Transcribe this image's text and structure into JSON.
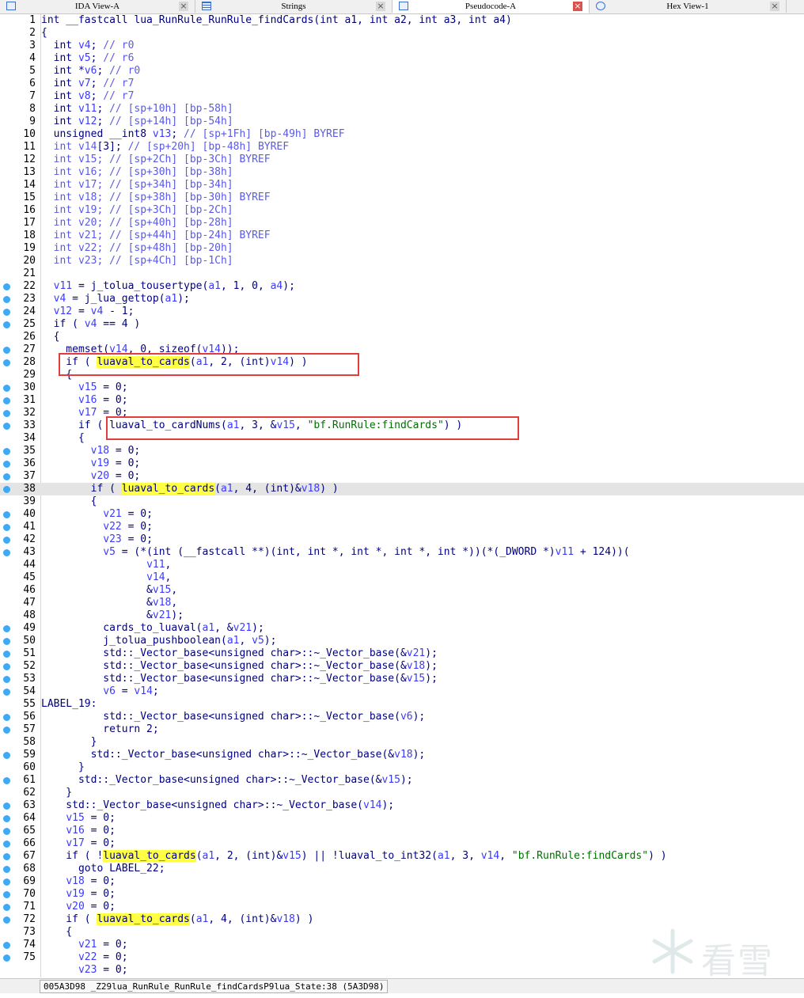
{
  "tabs": [
    {
      "label": "IDA View-A",
      "close": "×"
    },
    {
      "label": "Strings",
      "close": "×"
    },
    {
      "label": "Pseudocode-A",
      "close": "×"
    },
    {
      "label": "Hex View-1",
      "close": "×"
    }
  ],
  "current_line": 38,
  "highlighted_lines": [
    28,
    33
  ],
  "watermark": "看雪",
  "status": "005A3D98 _Z29lua_RunRule_RunRule_findCardsP9lua_State:38 (5A3D98)",
  "lines": [
    {
      "n": "1",
      "bp": false,
      "html": "int __fastcall lua_RunRule_RunRule_findCards(int a1, int a2, int a3, int a4)"
    },
    {
      "n": "2",
      "bp": false,
      "html": "{"
    },
    {
      "n": "3",
      "bp": false,
      "html": "  int <span class=\"v\">v4</span>; <span class=\"c\">// r0</span>"
    },
    {
      "n": "4",
      "bp": false,
      "html": "  int <span class=\"v\">v5</span>; <span class=\"c\">// r6</span>"
    },
    {
      "n": "5",
      "bp": false,
      "html": "  int *<span class=\"v\">v6</span>; <span class=\"c\">// r0</span>"
    },
    {
      "n": "6",
      "bp": false,
      "html": "  int <span class=\"v\">v7</span>; <span class=\"c\">// r7</span>"
    },
    {
      "n": "7",
      "bp": false,
      "html": "  int <span class=\"v\">v8</span>; <span class=\"c\">// r7</span>"
    },
    {
      "n": "8",
      "bp": false,
      "html": "  int <span class=\"v\">v11</span>; <span class=\"c\">// [sp+10h] [bp-58h]</span>"
    },
    {
      "n": "9",
      "bp": false,
      "html": "  int <span class=\"v\">v12</span>; <span class=\"c\">// [sp+14h] [bp-54h]</span>"
    },
    {
      "n": "10",
      "bp": false,
      "html": "  unsigned __int8 <span class=\"v\">v13</span>; <span class=\"c\">// [sp+1Fh] [bp-49h] BYREF</span>"
    },
    {
      "n": "11",
      "bp": false,
      "html": "  <span class=\"c\">int v14</span>[3]; <span class=\"c\">// [sp+20h] [bp-48h] BYREF</span>"
    },
    {
      "n": "12",
      "bp": false,
      "html": "  <span class=\"c\">int v15; // [sp+2Ch] [bp-3Ch] BYREF</span>"
    },
    {
      "n": "13",
      "bp": false,
      "html": "  <span class=\"c\">int v16; // [sp+30h] [bp-38h]</span>"
    },
    {
      "n": "14",
      "bp": false,
      "html": "  <span class=\"c\">int v17; // [sp+34h] [bp-34h]</span>"
    },
    {
      "n": "15",
      "bp": false,
      "html": "  <span class=\"c\">int v18; // [sp+38h] [bp-30h] BYREF</span>"
    },
    {
      "n": "16",
      "bp": false,
      "html": "  <span class=\"c\">int v19; // [sp+3Ch] [bp-2Ch]</span>"
    },
    {
      "n": "17",
      "bp": false,
      "html": "  <span class=\"c\">int v20; // [sp+40h] [bp-28h]</span>"
    },
    {
      "n": "18",
      "bp": false,
      "html": "  <span class=\"c\">int v21; // [sp+44h] [bp-24h] BYREF</span>"
    },
    {
      "n": "19",
      "bp": false,
      "html": "  <span class=\"c\">int v22; // [sp+48h] [bp-20h]</span>"
    },
    {
      "n": "20",
      "bp": false,
      "html": "  <span class=\"c\">int v23; // [sp+4Ch] [bp-1Ch]</span>"
    },
    {
      "n": "21",
      "bp": false,
      "html": ""
    },
    {
      "n": "22",
      "bp": true,
      "html": "  <span class=\"v\">v11</span> = j_tolua_tousertype(<span class=\"v\">a1</span>, 1, 0, <span class=\"v\">a4</span>);"
    },
    {
      "n": "23",
      "bp": true,
      "html": "  <span class=\"v\">v4</span> = j_lua_gettop(<span class=\"v\">a1</span>);"
    },
    {
      "n": "24",
      "bp": true,
      "html": "  <span class=\"v\">v12</span> = <span class=\"v\">v4</span> - 1;"
    },
    {
      "n": "25",
      "bp": true,
      "html": "  if ( <span class=\"v\">v4</span> == 4 )"
    },
    {
      "n": "26",
      "bp": false,
      "html": "  {"
    },
    {
      "n": "27",
      "bp": true,
      "html": "    memset(<span class=\"v\">v14</span>, 0, sizeof(<span class=\"v\">v14</span>));"
    },
    {
      "n": "28",
      "bp": true,
      "html": "    if ( <span class=\"hl\">luaval_to_cards</span>(<span class=\"v\">a1</span>, 2, (int)<span class=\"v\">v14</span>) )"
    },
    {
      "n": "29",
      "bp": false,
      "html": "    {"
    },
    {
      "n": "30",
      "bp": true,
      "html": "      <span class=\"v\">v15</span> = 0;"
    },
    {
      "n": "31",
      "bp": true,
      "html": "      <span class=\"v\">v16</span> = 0;"
    },
    {
      "n": "32",
      "bp": true,
      "html": "      <span class=\"v\">v17</span> = 0;"
    },
    {
      "n": "33",
      "bp": true,
      "html": "      if ( luaval_to_cardNums(<span class=\"v\">a1</span>, 3, &amp;<span class=\"v\">v15</span>, <span class=\"s\">\"bf.RunRule:findCards\"</span>) )"
    },
    {
      "n": "34",
      "bp": false,
      "html": "      {"
    },
    {
      "n": "35",
      "bp": true,
      "html": "        <span class=\"v\">v18</span> = 0;"
    },
    {
      "n": "36",
      "bp": true,
      "html": "        <span class=\"v\">v19</span> = 0;"
    },
    {
      "n": "37",
      "bp": true,
      "html": "        <span class=\"v\">v20</span> = 0;"
    },
    {
      "n": "38",
      "bp": true,
      "html": "        if ( <span class=\"hl\">luaval_to_cards</span>(<span class=\"v\">a1</span>, 4, (int)&amp;<span class=\"v\">v18</span>) )"
    },
    {
      "n": "39",
      "bp": false,
      "html": "        {"
    },
    {
      "n": "40",
      "bp": true,
      "html": "          <span class=\"v\">v21</span> = 0;"
    },
    {
      "n": "41",
      "bp": true,
      "html": "          <span class=\"v\">v22</span> = 0;"
    },
    {
      "n": "42",
      "bp": true,
      "html": "          <span class=\"v\">v23</span> = 0;"
    },
    {
      "n": "43",
      "bp": true,
      "html": "          <span class=\"v\">v5</span> = (*(int (__fastcall **)(int, int *, int *, int *, int *))(*(_DWORD *)<span class=\"v\">v11</span> + 124))("
    },
    {
      "n": "44",
      "bp": false,
      "html": "                 <span class=\"v\">v11</span>,"
    },
    {
      "n": "45",
      "bp": false,
      "html": "                 <span class=\"v\">v14</span>,"
    },
    {
      "n": "46",
      "bp": false,
      "html": "                 &amp;<span class=\"v\">v15</span>,"
    },
    {
      "n": "47",
      "bp": false,
      "html": "                 &amp;<span class=\"v\">v18</span>,"
    },
    {
      "n": "48",
      "bp": false,
      "html": "                 &amp;<span class=\"v\">v21</span>);"
    },
    {
      "n": "49",
      "bp": true,
      "html": "          cards_to_luaval(<span class=\"v\">a1</span>, &amp;<span class=\"v\">v21</span>);"
    },
    {
      "n": "50",
      "bp": true,
      "html": "          j_tolua_pushboolean(<span class=\"v\">a1</span>, <span class=\"v\">v5</span>);"
    },
    {
      "n": "51",
      "bp": true,
      "html": "          std::_Vector_base&lt;unsigned char&gt;::~_Vector_base(&amp;<span class=\"v\">v21</span>);"
    },
    {
      "n": "52",
      "bp": true,
      "html": "          std::_Vector_base&lt;unsigned char&gt;::~_Vector_base(&amp;<span class=\"v\">v18</span>);"
    },
    {
      "n": "53",
      "bp": true,
      "html": "          std::_Vector_base&lt;unsigned char&gt;::~_Vector_base(&amp;<span class=\"v\">v15</span>);"
    },
    {
      "n": "54",
      "bp": true,
      "html": "          <span class=\"v\">v6</span> = <span class=\"v\">v14</span>;"
    },
    {
      "n": "55",
      "bp": false,
      "html": "LABEL_19:"
    },
    {
      "n": "56",
      "bp": true,
      "html": "          std::_Vector_base&lt;unsigned char&gt;::~_Vector_base(<span class=\"v\">v6</span>);"
    },
    {
      "n": "57",
      "bp": true,
      "html": "          return 2;"
    },
    {
      "n": "58",
      "bp": false,
      "html": "        }"
    },
    {
      "n": "59",
      "bp": true,
      "html": "        std::_Vector_base&lt;unsigned char&gt;::~_Vector_base(&amp;<span class=\"v\">v18</span>);"
    },
    {
      "n": "60",
      "bp": false,
      "html": "      }"
    },
    {
      "n": "61",
      "bp": true,
      "html": "      std::_Vector_base&lt;unsigned char&gt;::~_Vector_base(&amp;<span class=\"v\">v15</span>);"
    },
    {
      "n": "62",
      "bp": false,
      "html": "    }"
    },
    {
      "n": "63",
      "bp": true,
      "html": "    std::_Vector_base&lt;unsigned char&gt;::~_Vector_base(<span class=\"v\">v14</span>);"
    },
    {
      "n": "64",
      "bp": true,
      "html": "    <span class=\"v\">v15</span> = 0;"
    },
    {
      "n": "65",
      "bp": true,
      "html": "    <span class=\"v\">v16</span> = 0;"
    },
    {
      "n": "66",
      "bp": true,
      "html": "    <span class=\"v\">v17</span> = 0;"
    },
    {
      "n": "67",
      "bp": true,
      "html": "    if ( !<span class=\"hl\">luaval_to_cards</span>(<span class=\"v\">a1</span>, 2, (int)&amp;<span class=\"v\">v15</span>) || !luaval_to_int32(<span class=\"v\">a1</span>, 3, <span class=\"v\">v14</span>, <span class=\"s\">\"bf.RunRule:findCards\"</span>) )"
    },
    {
      "n": "68",
      "bp": true,
      "html": "      goto LABEL_22;"
    },
    {
      "n": "69",
      "bp": true,
      "html": "    <span class=\"v\">v18</span> = 0;"
    },
    {
      "n": "70",
      "bp": true,
      "html": "    <span class=\"v\">v19</span> = 0;"
    },
    {
      "n": "71",
      "bp": true,
      "html": "    <span class=\"v\">v20</span> = 0;"
    },
    {
      "n": "72",
      "bp": true,
      "html": "    if ( <span class=\"hl\">luaval_to_cards</span>(<span class=\"v\">a1</span>, 4, (int)&amp;<span class=\"v\">v18</span>) )"
    },
    {
      "n": "73",
      "bp": false,
      "html": "    {"
    },
    {
      "n": "74",
      "bp": true,
      "html": "      <span class=\"v\">v21</span> = 0;"
    },
    {
      "n": "75",
      "bp": true,
      "html": "      <span class=\"v\">v22</span> = 0;"
    },
    {
      "n": "",
      "bp": false,
      "html": "      <span class=\"v\">v23</span> = 0;"
    }
  ]
}
